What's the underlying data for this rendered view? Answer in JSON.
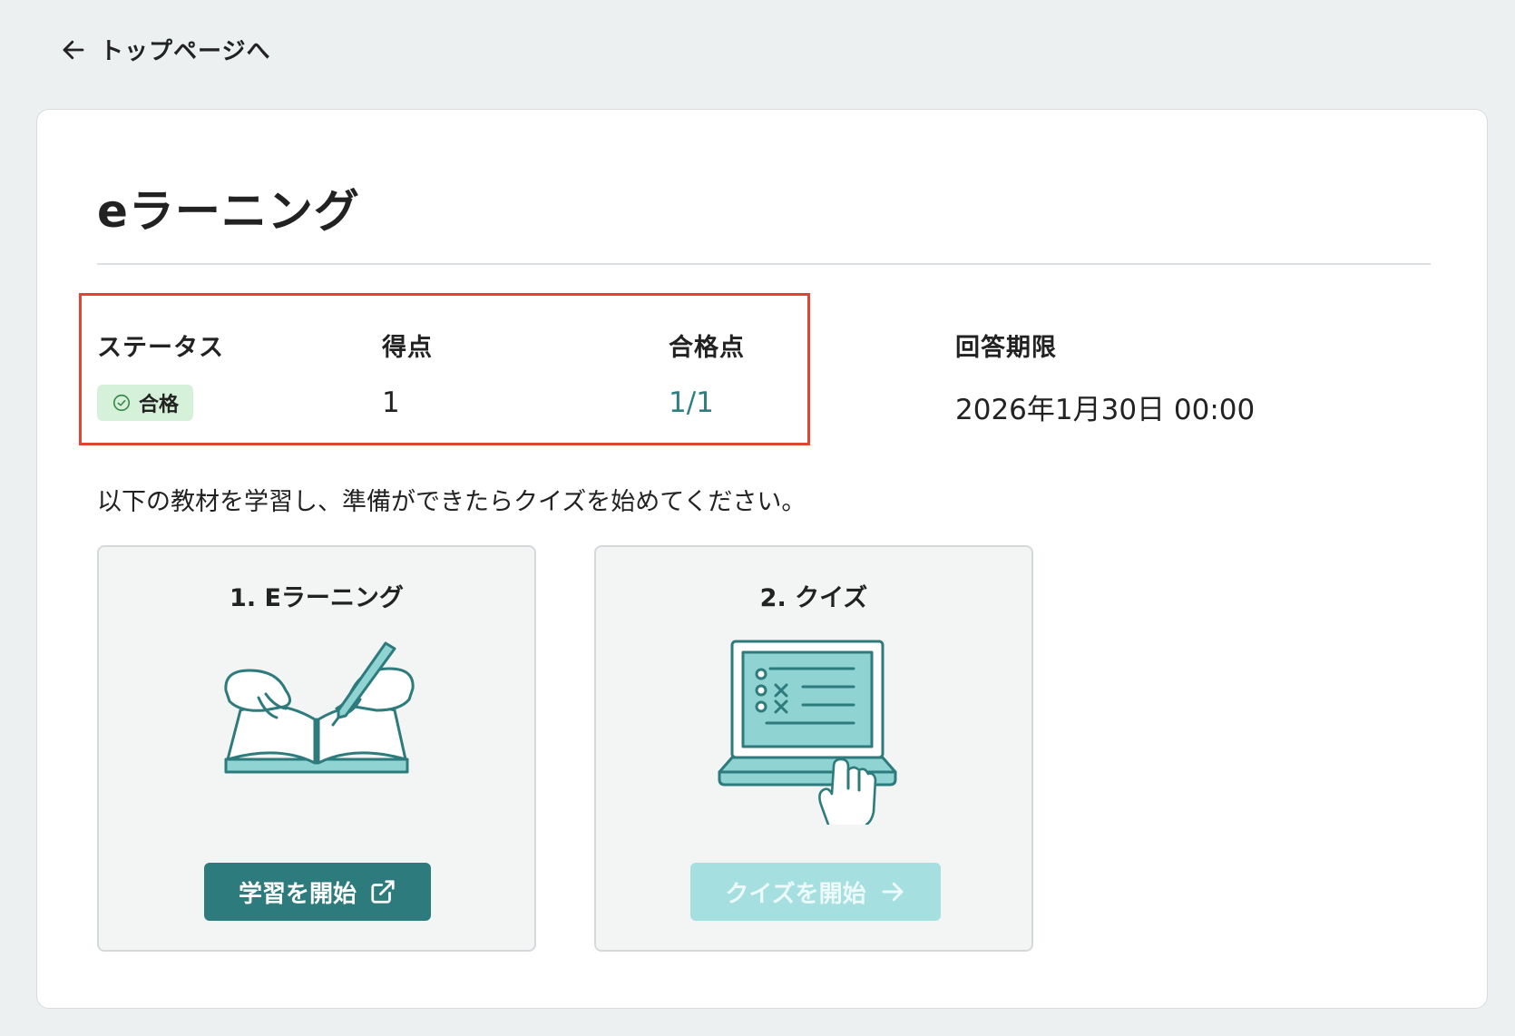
{
  "nav": {
    "back_label": "トップページへ"
  },
  "page": {
    "title": "eラーニング"
  },
  "info": {
    "status_label": "ステータス",
    "status_value": "合格",
    "score_label": "得点",
    "score_value": "1",
    "pass_label": "合格点",
    "pass_value": "1/1",
    "deadline_label": "回答期限",
    "deadline_value": "2026年1月30日 00:00"
  },
  "instruction": "以下の教材を学習し、準備ができたらクイズを始めてください。",
  "steps": [
    {
      "title": "1. Eラーニング",
      "button_label": "学習を開始",
      "button_icon": "external-link-icon"
    },
    {
      "title": "2. クイズ",
      "button_label": "クイズを開始",
      "button_icon": "arrow-right-icon"
    }
  ],
  "colors": {
    "accent": "#2d7b7c",
    "accent_light": "#a6dfe0",
    "badge_bg": "#d5f1d9",
    "highlight_border": "#e2452f",
    "link": "#2e7f82",
    "illustration_fill": "#8fd3d3"
  }
}
